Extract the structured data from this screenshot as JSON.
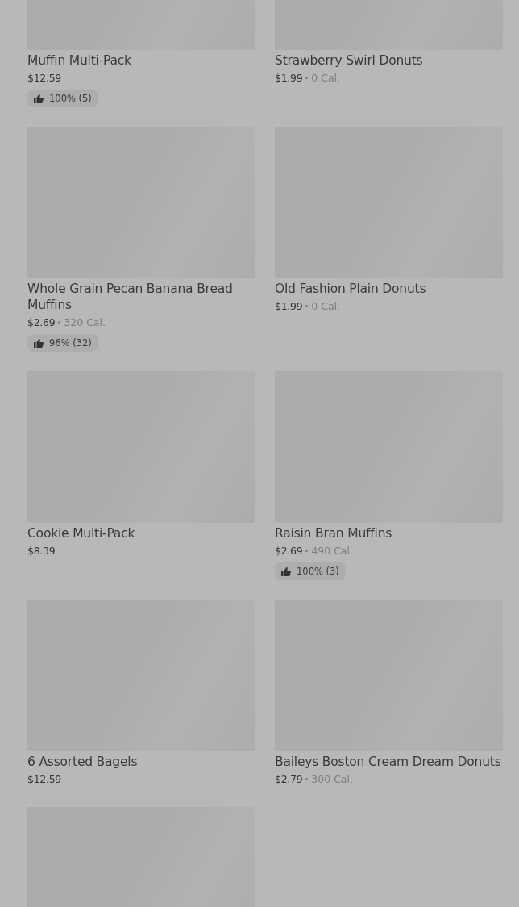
{
  "products": [
    {
      "kind": "product",
      "name": "Muffin Multi-Pack",
      "price": "$12.59",
      "rating": "100% (5)"
    },
    {
      "kind": "product",
      "name": "Strawberry Swirl Donuts",
      "price": "$1.99",
      "calories": "0 Cal."
    },
    {
      "kind": "product",
      "name": "Whole Grain Pecan Banana Bread Muffins",
      "price": "$2.69",
      "calories": "320 Cal.",
      "rating": "96% (32)"
    },
    {
      "kind": "product",
      "name": "Old Fashion Plain Donuts",
      "price": "$1.99",
      "calories": "0 Cal."
    },
    {
      "kind": "product",
      "name": "Cookie Multi-Pack",
      "price": "$8.39"
    },
    {
      "kind": "product",
      "name": "Raisin Bran Muffins",
      "price": "$2.69",
      "calories": "490 Cal.",
      "rating": "100% (3)"
    },
    {
      "kind": "product",
      "name": "6 Assorted Bagels",
      "price": "$12.59"
    },
    {
      "kind": "product",
      "name": "Baileys Boston Cream Dream Donuts",
      "price": "$2.79",
      "calories": "300 Cal."
    },
    {
      "kind": "picture"
    }
  ]
}
